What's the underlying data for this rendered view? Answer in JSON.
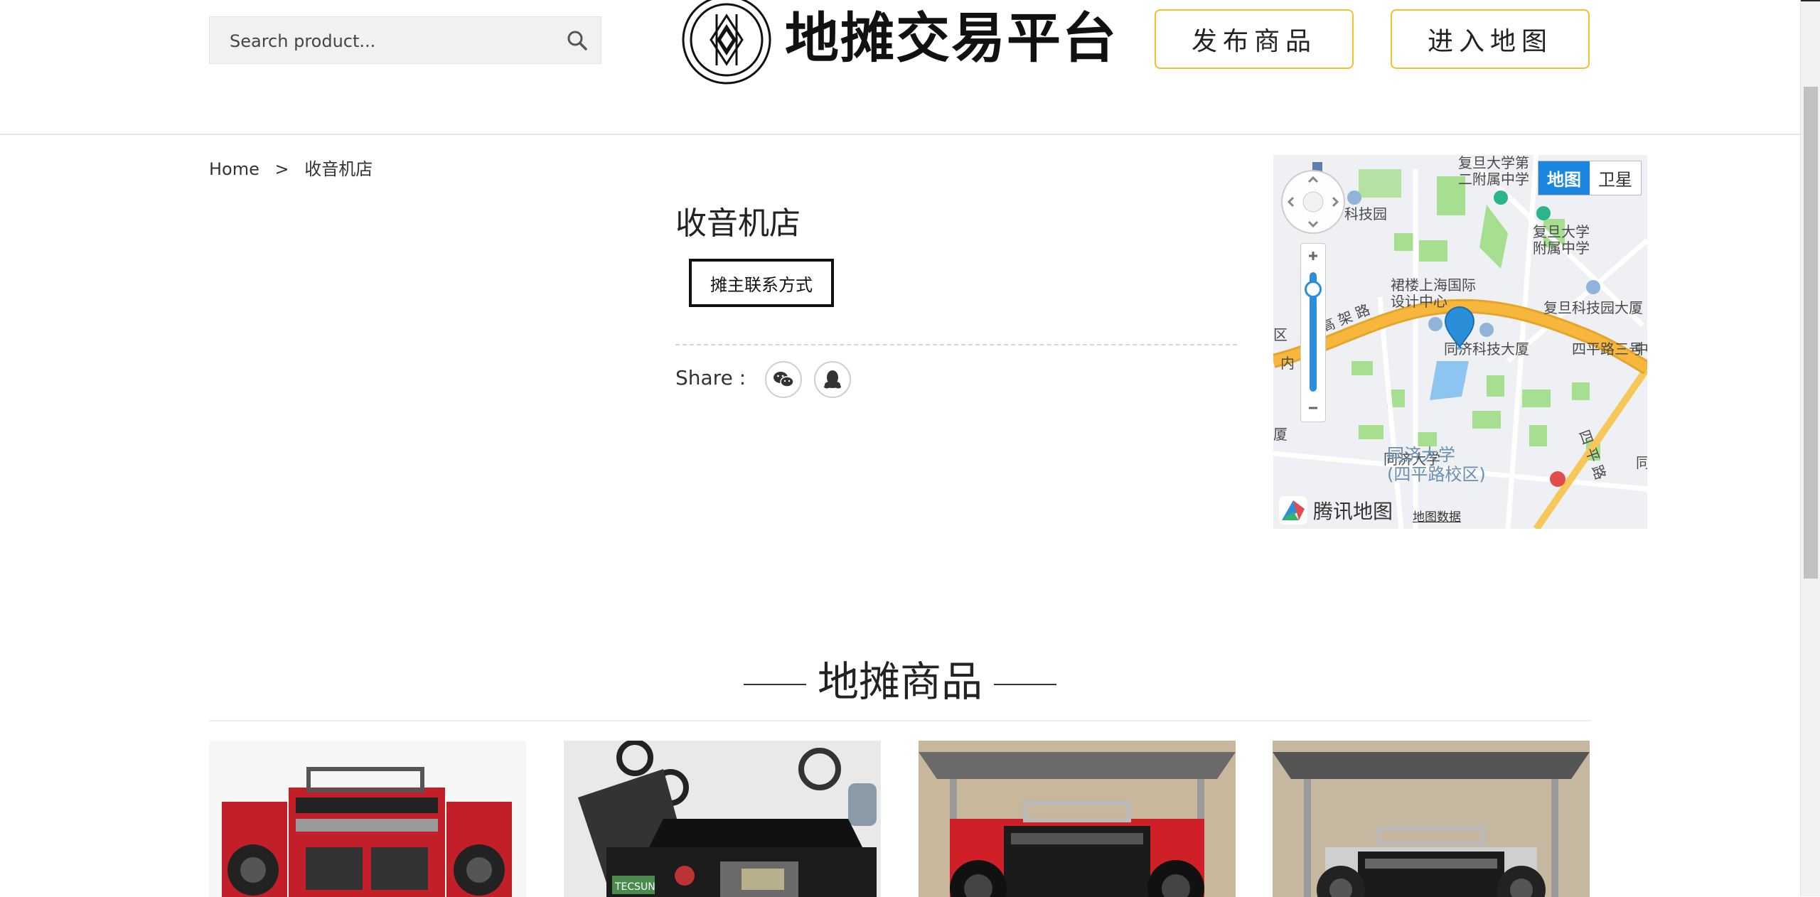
{
  "header": {
    "search": {
      "placeholder": "Search product..."
    },
    "logo_text": "地摊交易平台",
    "buttons": {
      "publish": "发布商品",
      "map": "进入地图"
    }
  },
  "breadcrumb": {
    "home": "Home",
    "separator": ">",
    "current": "收音机店"
  },
  "shop": {
    "title": "收音机店",
    "contact_button": "摊主联系方式",
    "share_label": "Share :"
  },
  "map": {
    "type_road": "地图",
    "type_satellite": "卫星",
    "brand": "腾讯地图",
    "data_link": "地图数据",
    "labels": {
      "tech_park_venture": "复旦科技园\n创业大厦",
      "fudan_second_attached": "复旦大学第\n二附属中学",
      "fudan_attached": "复旦大学\n附属中学",
      "shanghai_design": "裙楼上海国际\n设计中心",
      "fudan_tech_tower": "复旦科技园大厦",
      "tongji_tech_tower": "同济科技大厦",
      "siping_road_3": "四平路三号",
      "zhong": "中",
      "tongji_univ_campus": "同济大学\n(四平路校区)",
      "tongji_univ_station": "同济大学",
      "gaojia_road": "高 架 路",
      "nei": "内",
      "qu": "区",
      "xia": "厦",
      "tong": "同",
      "siping_road": "四 平 路",
      "keji_yuan": "科技园"
    },
    "colors": {
      "road": "#f6b73c",
      "green": "#a5df8f",
      "water": "#8ec5f0",
      "marker": "#2a8fd8"
    }
  },
  "section": {
    "title": "地摊商品"
  },
  "products": [
    {
      "id": 1,
      "image_desc": "red-radio-boombox"
    },
    {
      "id": 2,
      "image_desc": "tecsun-radio"
    },
    {
      "id": 3,
      "image_desc": "red-boombox"
    },
    {
      "id": 4,
      "image_desc": "silver-boombox"
    }
  ],
  "icons": {
    "search": "search-icon",
    "wechat": "wechat-icon",
    "qq": "qq-icon",
    "map_pan": "pan-control-icon",
    "zoom_in": "zoom-in-icon",
    "zoom_out": "zoom-out-icon",
    "marker": "map-marker-icon"
  },
  "colors": {
    "accent_border": "#f2c12e",
    "map_type_active": "#1a86e0"
  }
}
